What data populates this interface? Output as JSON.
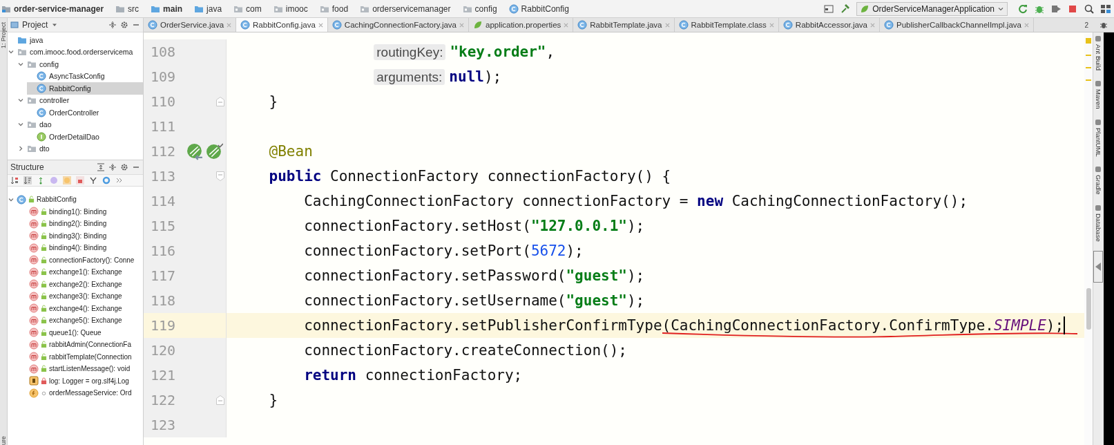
{
  "breadcrumbs": [
    {
      "label": "order-service-manager",
      "kind": "module",
      "bold": true
    },
    {
      "label": "src",
      "kind": "folder",
      "bold": false
    },
    {
      "label": "main",
      "kind": "source",
      "bold": true
    },
    {
      "label": "java",
      "kind": "source",
      "bold": false
    },
    {
      "label": "com",
      "kind": "package",
      "bold": false
    },
    {
      "label": "imooc",
      "kind": "package",
      "bold": false
    },
    {
      "label": "food",
      "kind": "package",
      "bold": false
    },
    {
      "label": "orderservicemanager",
      "kind": "package",
      "bold": false
    },
    {
      "label": "config",
      "kind": "package",
      "bold": false
    },
    {
      "label": "RabbitConfig",
      "kind": "class",
      "bold": false
    }
  ],
  "run_config": {
    "label": "OrderServiceManagerApplication"
  },
  "project": {
    "side_label": "1: Project",
    "title": "Project",
    "tree": [
      {
        "label": "java",
        "kind": "source",
        "selected": false
      },
      {
        "label": "com.imooc.food.orderservicema",
        "kind": "package",
        "selected": false,
        "expanded": true,
        "children": [
          {
            "label": "config",
            "kind": "package",
            "selected": false,
            "expanded": true,
            "children": [
              {
                "label": "AsyncTaskConfig",
                "kind": "class",
                "selected": false
              },
              {
                "label": "RabbitConfig",
                "kind": "class",
                "selected": true
              }
            ]
          },
          {
            "label": "controller",
            "kind": "package",
            "selected": false,
            "expanded": true,
            "children": [
              {
                "label": "OrderController",
                "kind": "class",
                "selected": false
              }
            ]
          },
          {
            "label": "dao",
            "kind": "package",
            "selected": false,
            "expanded": true,
            "children": [
              {
                "label": "OrderDetailDao",
                "kind": "interface",
                "selected": false
              }
            ]
          },
          {
            "label": "dto",
            "kind": "package",
            "selected": false,
            "expanded": false
          }
        ]
      }
    ]
  },
  "structure": {
    "side_label": "ure",
    "title": "Structure",
    "root": {
      "label": "RabbitConfig",
      "kind": "public-class",
      "selected": false,
      "expanded": true,
      "children": [
        {
          "label": "binding1(): Binding",
          "kind": "public-method",
          "selected": false
        },
        {
          "label": "binding2(): Binding",
          "kind": "public-method",
          "selected": false
        },
        {
          "label": "binding3(): Binding",
          "kind": "public-method",
          "selected": false
        },
        {
          "label": "binding4(): Binding",
          "kind": "public-method",
          "selected": false
        },
        {
          "label": "connectionFactory(): Conne",
          "kind": "public-method",
          "selected": false
        },
        {
          "label": "exchange1(): Exchange",
          "kind": "public-method",
          "selected": false
        },
        {
          "label": "exchange2(): Exchange",
          "kind": "public-method",
          "selected": false
        },
        {
          "label": "exchange3(): Exchange",
          "kind": "public-method",
          "selected": false
        },
        {
          "label": "exchange4(): Exchange",
          "kind": "public-method",
          "selected": false
        },
        {
          "label": "exchange5(): Exchange",
          "kind": "public-method",
          "selected": false
        },
        {
          "label": "queue1(): Queue",
          "kind": "public-method",
          "selected": false
        },
        {
          "label": "rabbitAdmin(ConnectionFa",
          "kind": "public-method",
          "selected": false
        },
        {
          "label": "rabbitTemplate(Connection",
          "kind": "public-method",
          "selected": false
        },
        {
          "label": "startListenMessage(): void",
          "kind": "public-method",
          "selected": false
        },
        {
          "label": "log: Logger = org.slf4j.Log",
          "kind": "private-static-field",
          "selected": false
        },
        {
          "label": "orderMessageService: Ord",
          "kind": "package-field",
          "selected": false
        }
      ]
    }
  },
  "tabs": [
    {
      "label": "OrderService.java",
      "kind": "class",
      "selected": false
    },
    {
      "label": "RabbitConfig.java",
      "kind": "class",
      "selected": true
    },
    {
      "label": "CachingConnectionFactory.java",
      "kind": "class",
      "selected": false
    },
    {
      "label": "application.properties",
      "kind": "properties",
      "selected": false
    },
    {
      "label": "RabbitTemplate.java",
      "kind": "class",
      "selected": false
    },
    {
      "label": "RabbitTemplate.class",
      "kind": "class",
      "selected": false
    },
    {
      "label": "RabbitAccessor.java",
      "kind": "class",
      "selected": false
    },
    {
      "label": "PublisherCallbackChannelImpl.java",
      "kind": "class",
      "selected": false
    }
  ],
  "tab_overflow": "2",
  "lines": [
    {
      "number": "108",
      "current": false,
      "kind": "args",
      "tokens": [
        {
          "kind": "hint",
          "text": "routingKey:"
        },
        {
          "kind": "string",
          "text": "\"key.order\""
        },
        {
          "kind": "plain",
          "text": ","
        }
      ]
    },
    {
      "number": "109",
      "current": false,
      "kind": "args",
      "tokens": [
        {
          "kind": "hint",
          "text": "arguments:"
        },
        {
          "kind": "keyword",
          "text": "null"
        },
        {
          "kind": "plain",
          "text": ");"
        }
      ]
    },
    {
      "number": "110",
      "current": false,
      "kind": "member-fold-end",
      "tokens": [
        {
          "kind": "plain",
          "text": "}"
        }
      ]
    },
    {
      "number": "111",
      "current": false
    },
    {
      "number": "112",
      "current": false,
      "kind": "member-beans",
      "tokens": [
        {
          "kind": "annotation",
          "text": "@Bean"
        }
      ]
    },
    {
      "number": "113",
      "current": false,
      "kind": "member-fold-start",
      "tokens": [
        {
          "kind": "keyword",
          "text": "public"
        },
        {
          "kind": "plain",
          "text": " ConnectionFactory connectionFactory() {"
        }
      ]
    },
    {
      "number": "114",
      "current": false,
      "kind": "body",
      "tokens": [
        {
          "kind": "plain",
          "text": "CachingConnectionFactory connectionFactory = "
        },
        {
          "kind": "keyword",
          "text": "new"
        },
        {
          "kind": "plain",
          "text": " CachingConnectionFactory();"
        }
      ]
    },
    {
      "number": "115",
      "current": false,
      "kind": "body",
      "tokens": [
        {
          "kind": "plain",
          "text": "connectionFactory.setHost("
        },
        {
          "kind": "string",
          "text": "\"127.0.0.1\""
        },
        {
          "kind": "plain",
          "text": ");"
        }
      ]
    },
    {
      "number": "116",
      "current": false,
      "kind": "body",
      "tokens": [
        {
          "kind": "plain",
          "text": "connectionFactory.setPort("
        },
        {
          "kind": "number",
          "text": "5672"
        },
        {
          "kind": "plain",
          "text": ");"
        }
      ]
    },
    {
      "number": "117",
      "current": false,
      "kind": "body",
      "tokens": [
        {
          "kind": "plain",
          "text": "connectionFactory.setPassword("
        },
        {
          "kind": "string",
          "text": "\"guest\""
        },
        {
          "kind": "plain",
          "text": ");"
        }
      ]
    },
    {
      "number": "118",
      "current": false,
      "kind": "body",
      "tokens": [
        {
          "kind": "plain",
          "text": "connectionFactory.setUsername("
        },
        {
          "kind": "string",
          "text": "\"guest\""
        },
        {
          "kind": "plain",
          "text": ");"
        }
      ]
    },
    {
      "number": "119",
      "current": true,
      "kind": "body",
      "tokens": [
        {
          "kind": "plain",
          "text": "connectionFactory.setPublisherConfirmType",
          "underlined": false
        },
        {
          "kind": "plain",
          "text": "(CachingConnectionFactory.ConfirmType.",
          "underlined": true
        },
        {
          "kind": "constant",
          "text": "SIMPLE",
          "underlined": true
        },
        {
          "kind": "plain",
          "text": ");",
          "underlined": true
        }
      ]
    },
    {
      "number": "120",
      "current": false,
      "kind": "body",
      "tokens": [
        {
          "kind": "plain",
          "text": "connectionFactory.createConnection();"
        }
      ]
    },
    {
      "number": "121",
      "current": false,
      "kind": "body",
      "tokens": [
        {
          "kind": "keyword",
          "text": "return"
        },
        {
          "kind": "plain",
          "text": " connectionFactory;"
        }
      ]
    },
    {
      "number": "122",
      "current": false,
      "kind": "member-fold-end",
      "tokens": [
        {
          "kind": "plain",
          "text": "}"
        }
      ]
    },
    {
      "number": "123",
      "current": false
    }
  ],
  "tool_windows": [
    {
      "label": "Ant Build"
    },
    {
      "label": "Maven"
    },
    {
      "label": "PlantUML"
    },
    {
      "label": "Gradle"
    },
    {
      "label": "Database"
    }
  ]
}
